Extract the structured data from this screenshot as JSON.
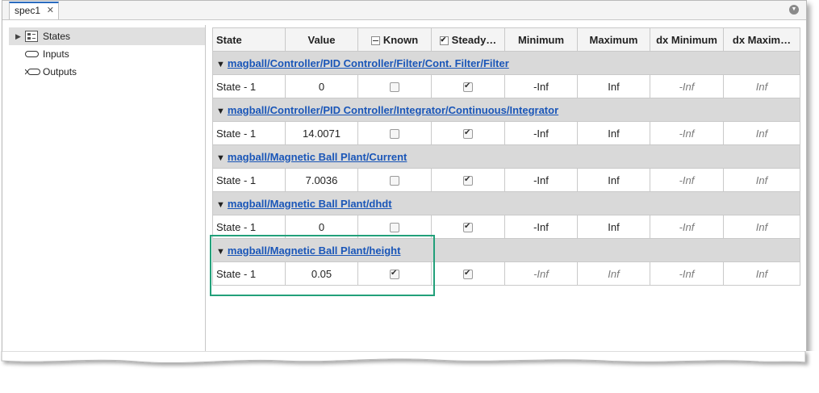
{
  "tab": {
    "title": "spec1",
    "close": "✕"
  },
  "sidebar": {
    "items": [
      {
        "label": "States"
      },
      {
        "label": "Inputs"
      },
      {
        "label": "Outputs"
      }
    ]
  },
  "table": {
    "columns": [
      "State",
      "Value",
      "Known",
      "Steady…",
      "Minimum",
      "Maximum",
      "dx Minimum",
      "dx Maxim…"
    ],
    "groups": [
      {
        "path": "magball/Controller/PID Controller/Filter/Cont. Filter/Filter",
        "row": {
          "state": "State - 1",
          "value": "0",
          "known": false,
          "steady": true,
          "min": "-Inf",
          "max": "Inf",
          "dxmin": "-Inf",
          "dxmax": "Inf"
        }
      },
      {
        "path": "magball/Controller/PID Controller/Integrator/Continuous/Integrator",
        "row": {
          "state": "State - 1",
          "value": "14.0071",
          "known": false,
          "steady": true,
          "min": "-Inf",
          "max": "Inf",
          "dxmin": "-Inf",
          "dxmax": "Inf"
        }
      },
      {
        "path": "magball/Magnetic Ball Plant/Current",
        "row": {
          "state": "State - 1",
          "value": "7.0036",
          "known": false,
          "steady": true,
          "min": "-Inf",
          "max": "Inf",
          "dxmin": "-Inf",
          "dxmax": "Inf"
        }
      },
      {
        "path": "magball/Magnetic Ball Plant/dhdt",
        "row": {
          "state": "State - 1",
          "value": "0",
          "known": false,
          "steady": true,
          "min": "-Inf",
          "max": "Inf",
          "dxmin": "-Inf",
          "dxmax": "Inf"
        }
      },
      {
        "path": "magball/Magnetic Ball Plant/height",
        "row": {
          "state": "State - 1",
          "value": "0.05",
          "known": true,
          "steady": true,
          "min": "-Inf",
          "max": "Inf",
          "dxmin": "-Inf",
          "dxmax": "Inf"
        }
      }
    ]
  },
  "colors": {
    "link": "#1a56b8",
    "highlight": "#22a07a",
    "tab_accent": "#2a6bbf"
  }
}
